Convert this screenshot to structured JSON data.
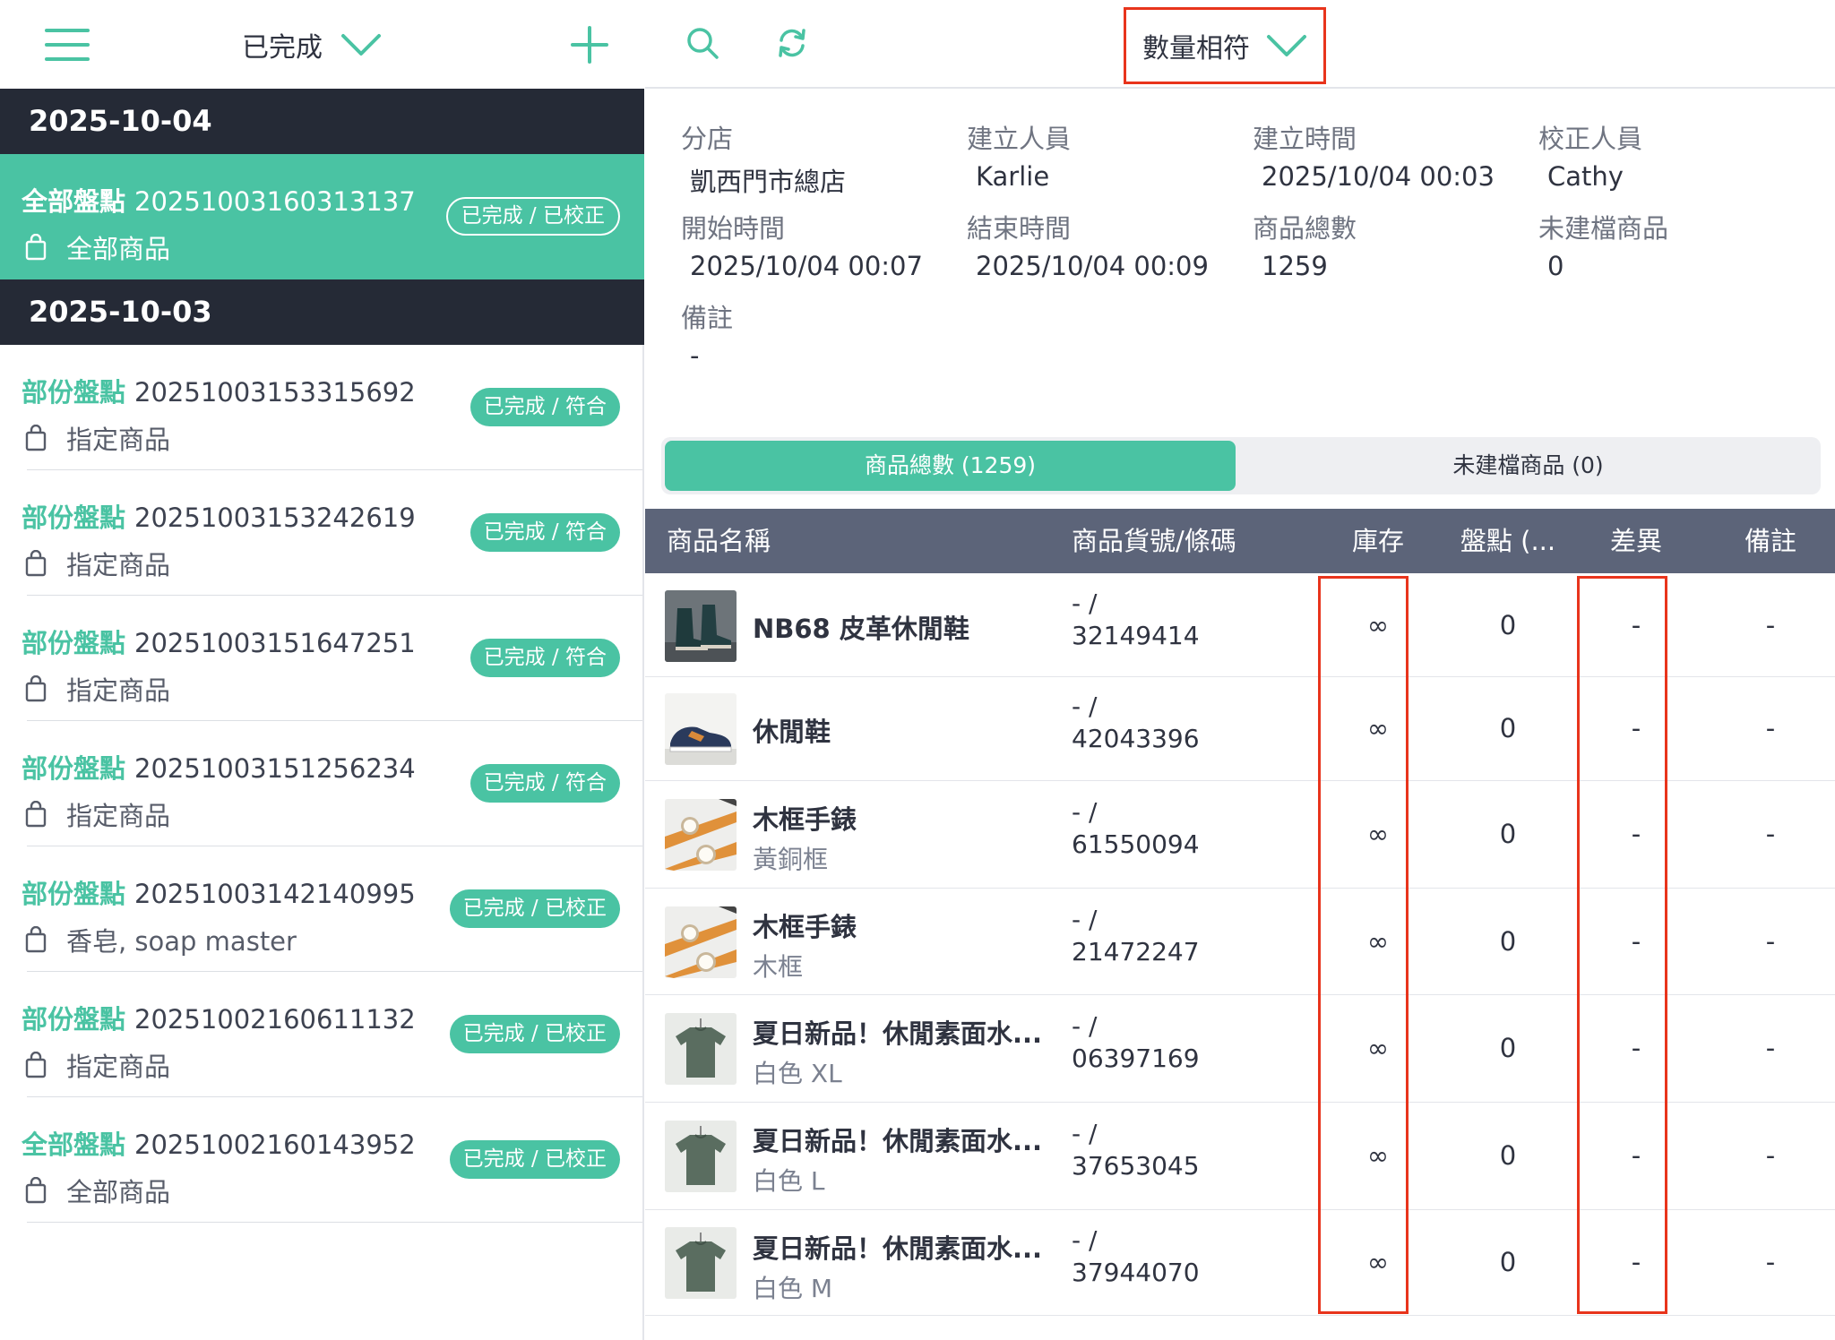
{
  "left": {
    "filter_label": "已完成",
    "groups": [
      {
        "date": "2025-10-04",
        "records": [
          {
            "type": "全部盤點",
            "number": "20251003160313137",
            "scope": "全部商品",
            "status": "已完成 / 已校正",
            "selected": true
          }
        ]
      },
      {
        "date": "2025-10-03",
        "records": [
          {
            "type": "部份盤點",
            "number": "20251003153315692",
            "scope": "指定商品",
            "status": "已完成 / 符合"
          },
          {
            "type": "部份盤點",
            "number": "20251003153242619",
            "scope": "指定商品",
            "status": "已完成 / 符合"
          },
          {
            "type": "部份盤點",
            "number": "20251003151647251",
            "scope": "指定商品",
            "status": "已完成 / 符合"
          },
          {
            "type": "部份盤點",
            "number": "20251003151256234",
            "scope": "指定商品",
            "status": "已完成 / 符合"
          },
          {
            "type": "部份盤點",
            "number": "20251003142140995",
            "scope": "香皂, soap master",
            "status": "已完成 / 已校正"
          },
          {
            "type": "部份盤點",
            "number": "20251002160611132",
            "scope": "指定商品",
            "status": "已完成 / 已校正"
          },
          {
            "type": "全部盤點",
            "number": "20251002160143952",
            "scope": "全部商品",
            "status": "已完成 / 已校正"
          }
        ]
      }
    ]
  },
  "toolbar": {
    "status_filter": "數量相符"
  },
  "info": {
    "branch_label": "分店",
    "branch": "凱西門市總店",
    "creator_label": "建立人員",
    "creator": "Karlie",
    "created_label": "建立時間",
    "created": "2025/10/04 00:03",
    "corrector_label": "校正人員",
    "corrector": "Cathy",
    "start_label": "開始時間",
    "start": "2025/10/04 00:07",
    "end_label": "結束時間",
    "end": "2025/10/04 00:09",
    "total_label": "商品總數",
    "total": "1259",
    "unfiled_label": "未建檔商品",
    "unfiled": "0",
    "note_label": "備註",
    "note": "-"
  },
  "tabs": {
    "all": "商品總數 (1259)",
    "unfiled": "未建檔商品 (0)"
  },
  "table": {
    "columns": {
      "name": "商品名稱",
      "code": "商品貨號/條碼",
      "stock": "庫存",
      "count": "盤點 (...",
      "diff": "差異",
      "note": "備註"
    },
    "rows": [
      {
        "thumb": "boots",
        "name": "NB68 皮革休閒鞋",
        "variant": "",
        "code_line1": "- /",
        "code_line2": "32149414",
        "stock": "∞",
        "count": "0",
        "diff": "-",
        "note": "-"
      },
      {
        "thumb": "sneaker",
        "name": "休閒鞋",
        "variant": "",
        "code_line1": "- /",
        "code_line2": "42043396",
        "stock": "∞",
        "count": "0",
        "diff": "-",
        "note": "-"
      },
      {
        "thumb": "watch",
        "name": "木框手錶",
        "variant": "黃銅框",
        "code_line1": "- /",
        "code_line2": "61550094",
        "stock": "∞",
        "count": "0",
        "diff": "-",
        "note": "-"
      },
      {
        "thumb": "watch",
        "name": "木框手錶",
        "variant": "木框",
        "code_line1": "- /",
        "code_line2": "21472247",
        "stock": "∞",
        "count": "0",
        "diff": "-",
        "note": "-"
      },
      {
        "thumb": "tshirt",
        "name": "夏日新品！休閒素面水...",
        "variant": "白色 XL",
        "code_line1": "- /",
        "code_line2": "06397169",
        "stock": "∞",
        "count": "0",
        "diff": "-",
        "note": "-"
      },
      {
        "thumb": "tshirt",
        "name": "夏日新品！休閒素面水...",
        "variant": "白色 L",
        "code_line1": "- /",
        "code_line2": "37653045",
        "stock": "∞",
        "count": "0",
        "diff": "-",
        "note": "-"
      },
      {
        "thumb": "tshirt",
        "name": "夏日新品！休閒素面水...",
        "variant": "白色 M",
        "code_line1": "- /",
        "code_line2": "37944070",
        "stock": "∞",
        "count": "0",
        "diff": "-",
        "note": "-"
      }
    ]
  },
  "colors": {
    "accent": "#4ac3a3",
    "dark_header": "#252a36",
    "table_header": "#5c6479",
    "highlight": "#e8341c"
  }
}
